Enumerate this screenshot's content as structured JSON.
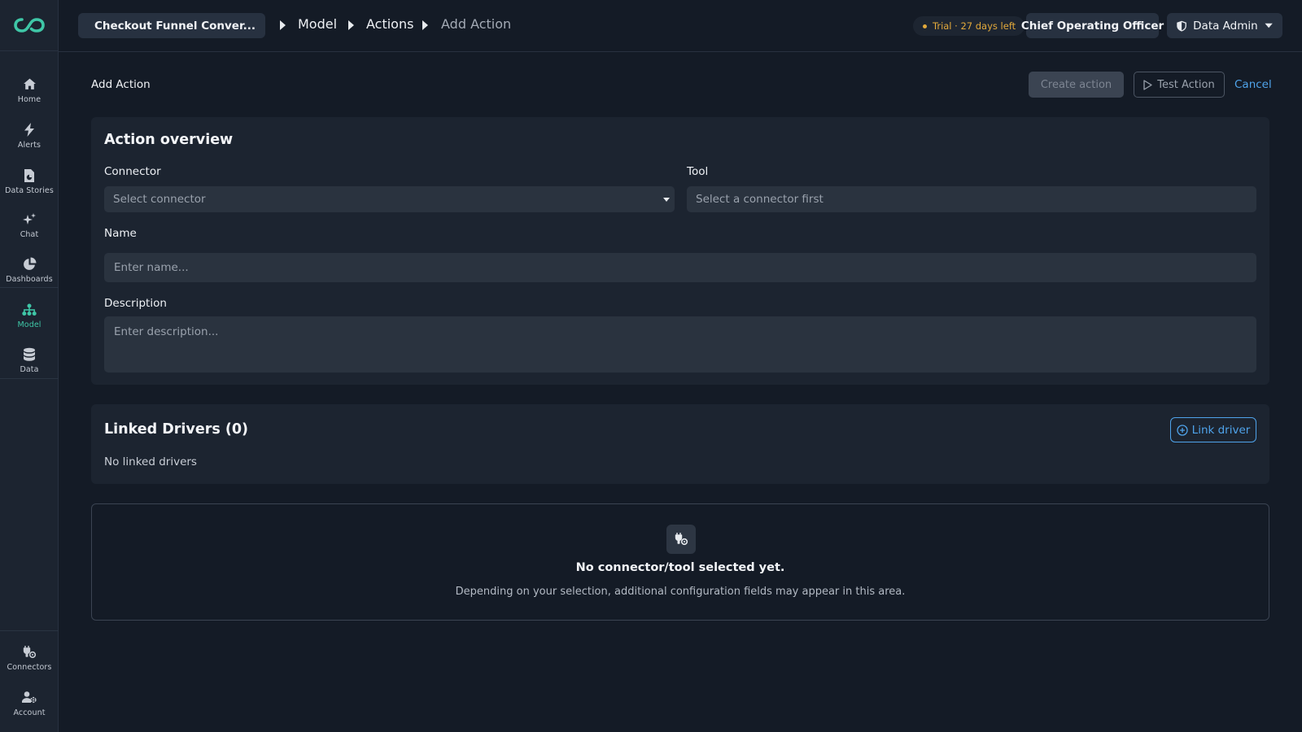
{
  "sidebar": {
    "items": [
      {
        "label": "Home",
        "icon": "home-icon"
      },
      {
        "label": "Alerts",
        "icon": "bolt-icon"
      },
      {
        "label": "Data Stories",
        "icon": "data-stories-icon"
      },
      {
        "label": "Chat",
        "icon": "sparkle-icon"
      },
      {
        "label": "Dashboards",
        "icon": "pie-chart-icon"
      },
      {
        "label": "Model",
        "icon": "hierarchy-icon",
        "active": true
      },
      {
        "label": "Data",
        "icon": "database-icon"
      }
    ],
    "bottom_items": [
      {
        "label": "Connectors",
        "icon": "plug-icon"
      },
      {
        "label": "Account",
        "icon": "user-gear-icon"
      }
    ]
  },
  "header": {
    "project": "Checkout Funnel Conver...",
    "breadcrumbs": [
      "Model",
      "Actions",
      "Add Action"
    ],
    "trial": "Trial · 27 days left",
    "role": "Chief Operating Officer",
    "admin": "Data Admin"
  },
  "page": {
    "title": "Add Action",
    "create_label": "Create action",
    "test_label": "Test Action",
    "cancel_label": "Cancel"
  },
  "overview": {
    "title": "Action overview",
    "connector_label": "Connector",
    "connector_placeholder": "Select connector",
    "tool_label": "Tool",
    "tool_placeholder": "Select a connector first",
    "name_label": "Name",
    "name_placeholder": "Enter name...",
    "description_label": "Description",
    "description_placeholder": "Enter description..."
  },
  "drivers": {
    "title": "Linked Drivers (0)",
    "link_label": "Link driver",
    "empty_text": "No linked drivers"
  },
  "empty_state": {
    "title": "No connector/tool selected yet.",
    "subtitle": "Depending on your selection, additional configuration fields may appear in this area."
  },
  "colors": {
    "accent": "#3fc7a7",
    "link": "#4fa3ea",
    "warning": "#e2a93b"
  }
}
